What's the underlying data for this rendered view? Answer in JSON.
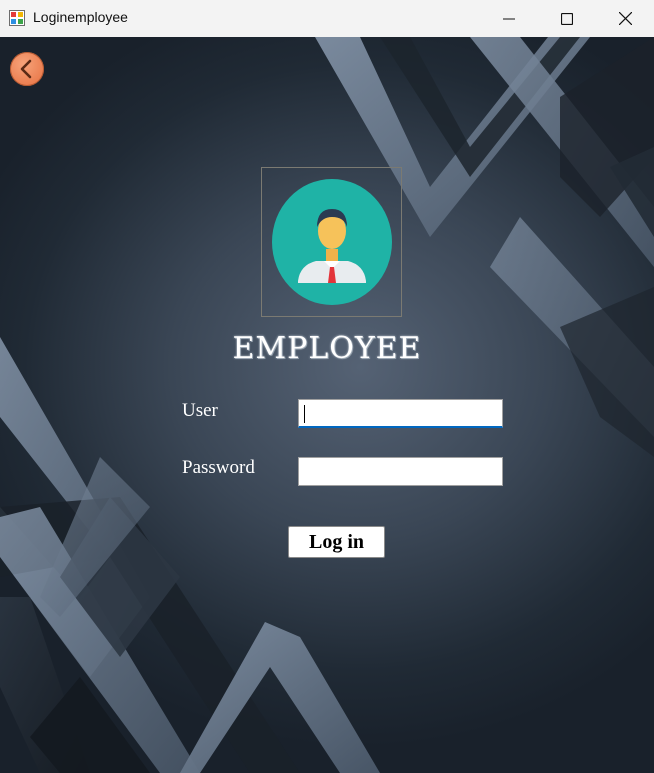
{
  "window": {
    "title": "Loginemployee",
    "icon": "app-form-icon",
    "controls": [
      "minimize-icon",
      "maximize-icon",
      "close-icon"
    ]
  },
  "nav": {
    "back_icon": "chevron-left-icon",
    "back_color": "#e97a4d"
  },
  "avatar": {
    "icon": "employee-avatar-icon",
    "circle_color": "#1fb3a6"
  },
  "heading": "EMPLOYEE",
  "form": {
    "user_label": "User",
    "user_value": "",
    "password_label": "Password",
    "password_value": "",
    "login_label": "Log in"
  },
  "colors": {
    "background": "#2f3a47",
    "accent": "#0067c0"
  }
}
